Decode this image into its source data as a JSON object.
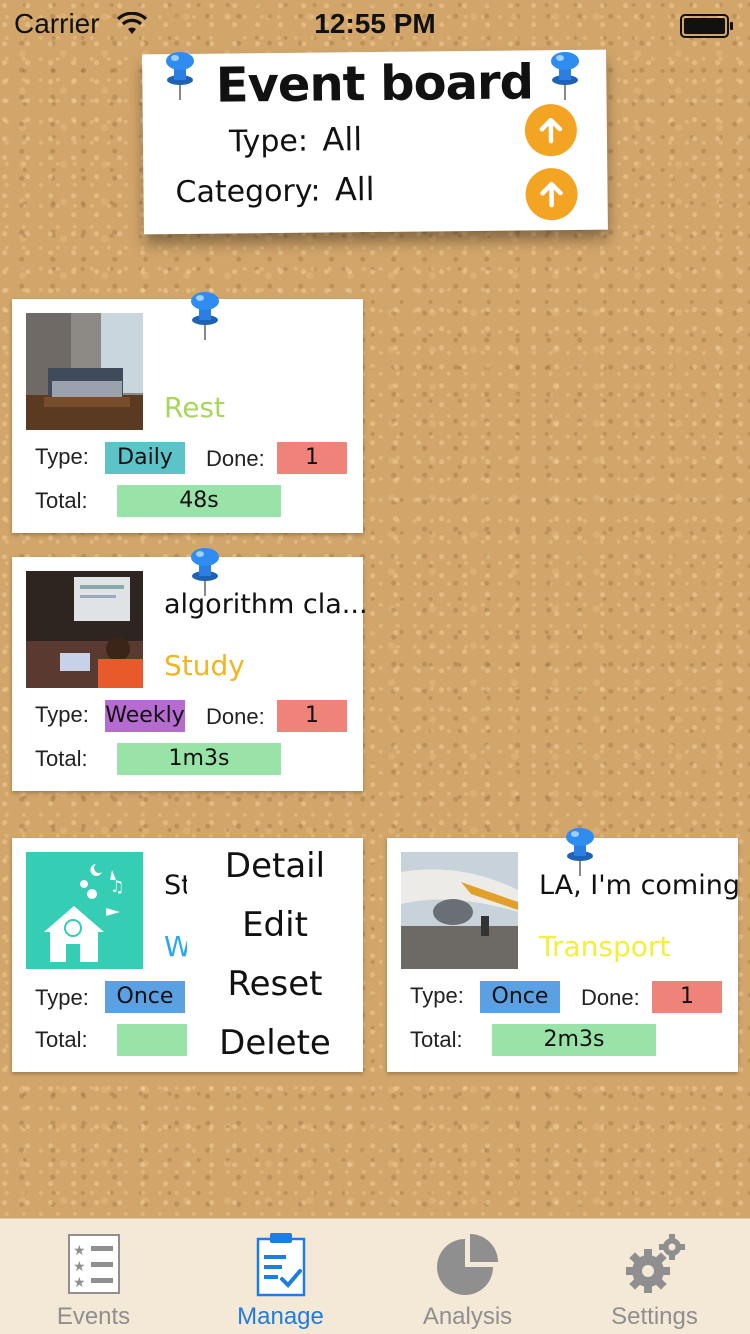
{
  "status_bar": {
    "carrier": "Carrier",
    "time": "12:55 PM"
  },
  "header": {
    "title": "Event board",
    "type_label": "Type:",
    "type_value": "All",
    "category_label": "Category:",
    "category_value": "All"
  },
  "labels": {
    "type": "Type:",
    "done": "Done:",
    "total": "Total:"
  },
  "events": [
    {
      "title": "",
      "category": "Rest",
      "type": "Daily",
      "done": "1",
      "total": "48s"
    },
    {
      "title": "algorithm cla...",
      "category": "Study",
      "type": "Weekly",
      "done": "1",
      "total": "1m3s"
    },
    {
      "title": "St",
      "category": "W",
      "type": "Once",
      "done": "",
      "total": ""
    },
    {
      "title": "LA, I'm coming",
      "category": "Transport",
      "type": "Once",
      "done": "1",
      "total": "2m3s"
    }
  ],
  "context_menu": {
    "items": [
      "Detail",
      "Edit",
      "Reset",
      "Delete"
    ]
  },
  "tabs": [
    {
      "label": "Events",
      "active": false
    },
    {
      "label": "Manage",
      "active": true
    },
    {
      "label": "Analysis",
      "active": false
    },
    {
      "label": "Settings",
      "active": false
    }
  ],
  "colors": {
    "accent": "#1e7de0",
    "inactive": "#8f8f8f",
    "filter_button": "#f3a423",
    "tag_daily": "#5cc3c9",
    "tag_weekly": "#b56bd0",
    "tag_once": "#5ba0e2",
    "tag_done": "#ef837a",
    "tag_total": "#9ae3a8",
    "category_rest": "#a7d65a",
    "category_study": "#f2b51e",
    "category_work": "#28a8f0",
    "category_transport": "#f4ee3c"
  }
}
